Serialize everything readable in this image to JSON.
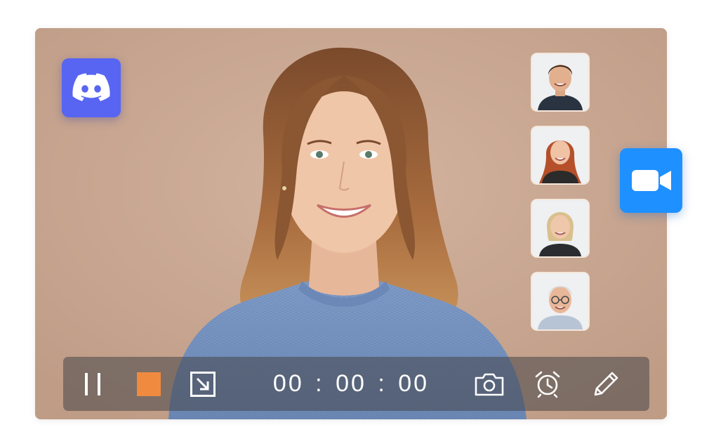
{
  "app": {
    "logo_icon": "discord-logo-icon",
    "accent_discord": "#5865f2",
    "zoom_icon": "video-camera-icon",
    "accent_zoom": "#1e90ff"
  },
  "participants": [
    {
      "icon": "participant-man-avatar"
    },
    {
      "icon": "participant-redhead-woman-avatar"
    },
    {
      "icon": "participant-blonde-woman-avatar"
    },
    {
      "icon": "participant-older-man-avatar"
    }
  ],
  "controls": {
    "pause_icon": "pause-icon",
    "stop_icon": "stop-icon",
    "stop_color": "#f08a3e",
    "resize_icon": "resize-icon",
    "timer": "00 : 00 : 00",
    "screenshot_icon": "camera-icon",
    "schedule_icon": "alarm-clock-icon",
    "annotate_icon": "pencil-icon"
  }
}
